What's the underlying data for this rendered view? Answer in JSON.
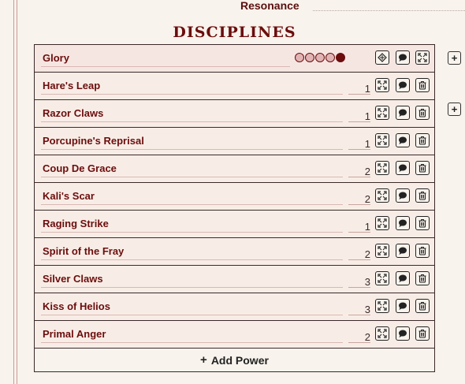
{
  "resonance": {
    "label": "Resonance"
  },
  "section": {
    "title": "DISCIPLINES"
  },
  "discipline": {
    "name": "Glory",
    "dots_total": 5,
    "dots_filled": 1,
    "buttons": [
      "rouse-icon",
      "comment-icon",
      "expand-icon"
    ]
  },
  "powers": [
    {
      "name": "Hare's Leap",
      "level": "1"
    },
    {
      "name": "Razor Claws",
      "level": "1"
    },
    {
      "name": "Porcupine's Reprisal",
      "level": "1"
    },
    {
      "name": "Coup De Grace",
      "level": "2"
    },
    {
      "name": "Kali's Scar",
      "level": "2"
    },
    {
      "name": "Raging Strike",
      "level": "1"
    },
    {
      "name": "Spirit of the Fray",
      "level": "2"
    },
    {
      "name": "Silver Claws",
      "level": "3"
    },
    {
      "name": "Kiss of Helios",
      "level": "3"
    },
    {
      "name": "Primal Anger",
      "level": "2"
    }
  ],
  "power_buttons": [
    "expand-icon",
    "comment-icon",
    "trash-icon"
  ],
  "add_power": {
    "plus": "+",
    "label": "Add Power"
  },
  "side_buttons": [
    "+",
    "+"
  ],
  "colors": {
    "accent": "#6b0d0d",
    "background": "#f8f3ec",
    "row_bg": "#f8ede6",
    "border": "#3a2a2a"
  }
}
